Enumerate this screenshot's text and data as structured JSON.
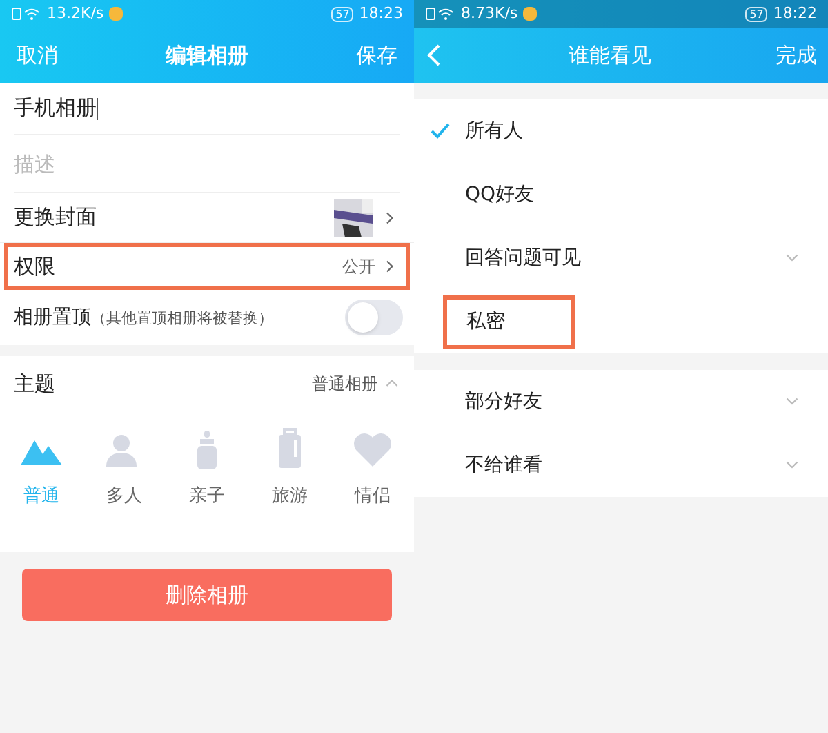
{
  "edit_album": {
    "status_bar": {
      "speed": "13.2K/s",
      "battery": "57",
      "time": "18:23"
    },
    "header": {
      "cancel": "取消",
      "title": "编辑相册",
      "save": "保存"
    },
    "name_field": {
      "value": "手机相册"
    },
    "description_field": {
      "placeholder": "描述"
    },
    "cover_row": {
      "label": "更换封面"
    },
    "permission_row": {
      "label": "权限",
      "value": "公开",
      "highlighted": true
    },
    "pin_row": {
      "label": "相册置顶",
      "note": "（其他置顶相册将被替换）",
      "on": false
    },
    "theme": {
      "label": "主题",
      "value": "普通相册",
      "expanded": true,
      "items": [
        {
          "kind": "mountain",
          "label": "普通",
          "selected": true
        },
        {
          "kind": "people",
          "label": "多人",
          "selected": false
        },
        {
          "kind": "bottle",
          "label": "亲子",
          "selected": false
        },
        {
          "kind": "suitcase",
          "label": "旅游",
          "selected": false
        },
        {
          "kind": "heart",
          "label": "情侣",
          "selected": false
        }
      ]
    },
    "delete_button": "删除相册"
  },
  "visibility": {
    "status_bar": {
      "speed": "8.73K/s",
      "battery": "57",
      "time": "18:22"
    },
    "header": {
      "title": "谁能看见",
      "done": "完成"
    },
    "groups": [
      [
        {
          "label": "所有人",
          "selected": true,
          "expandable": false,
          "highlighted": false
        },
        {
          "label": "QQ好友",
          "selected": false,
          "expandable": false,
          "highlighted": false
        },
        {
          "label": "回答问题可见",
          "selected": false,
          "expandable": true,
          "highlighted": false
        },
        {
          "label": "私密",
          "selected": false,
          "expandable": false,
          "highlighted": true
        }
      ],
      [
        {
          "label": "部分好友",
          "selected": false,
          "expandable": true,
          "highlighted": false
        },
        {
          "label": "不给谁看",
          "selected": false,
          "expandable": true,
          "highlighted": false
        }
      ]
    ]
  }
}
